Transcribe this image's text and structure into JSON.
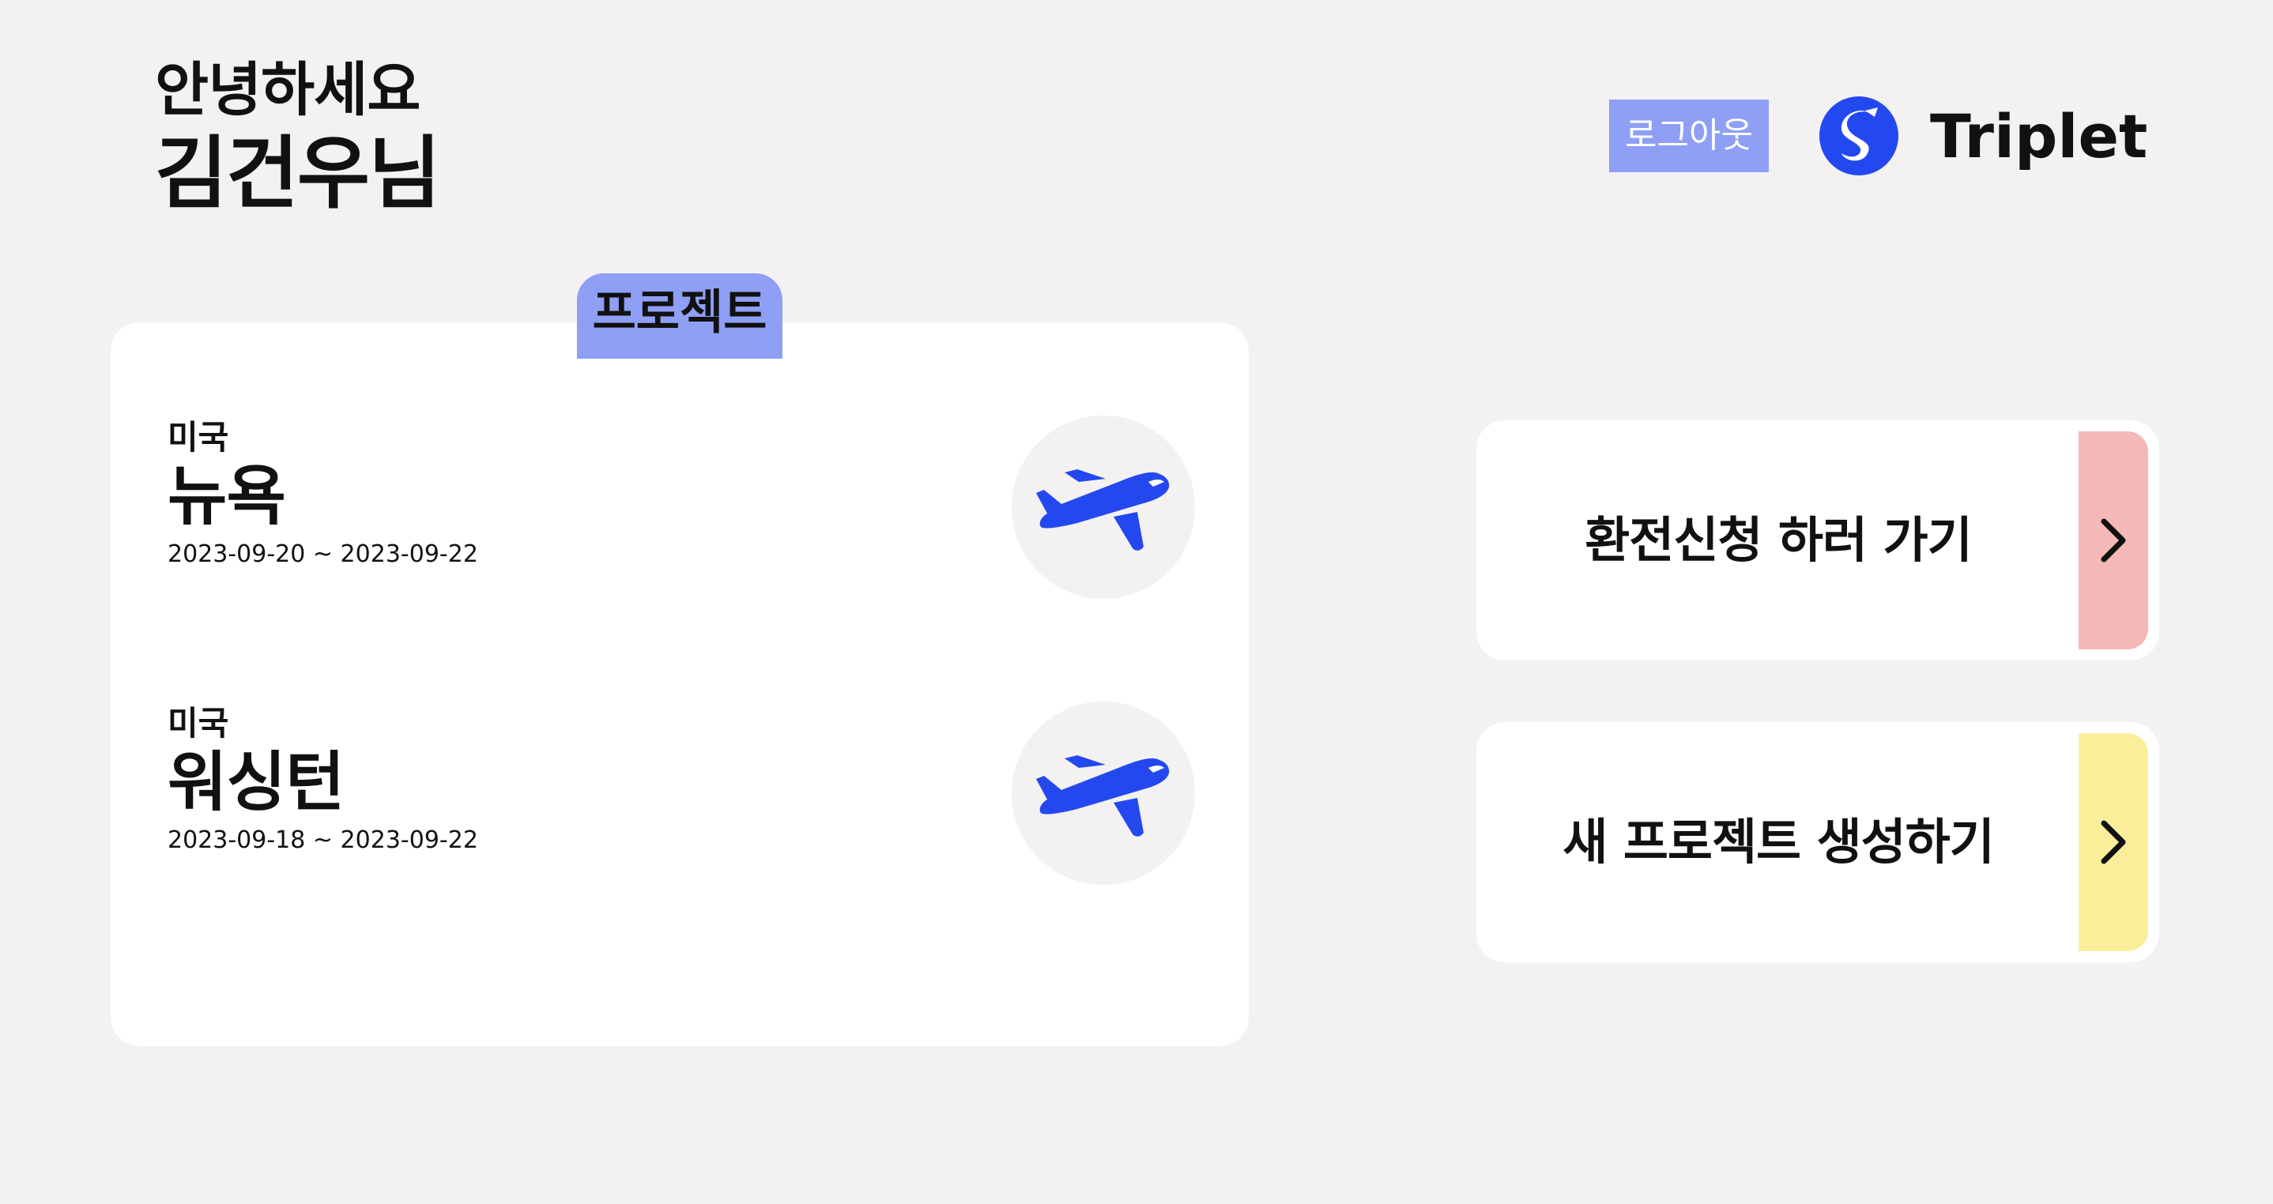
{
  "header": {
    "greeting": "안녕하세요",
    "user_name": "김건우님",
    "logout_label": "로그아웃",
    "brand_name": "Triplet",
    "logo_icon": "shinhan-s-icon"
  },
  "projects": {
    "tab_label": "프로젝트",
    "items": [
      {
        "country": "미국",
        "city": "뉴욕",
        "dates": "2023-09-20 ~ 2023-09-22",
        "icon": "airplane-icon"
      },
      {
        "country": "미국",
        "city": "워싱턴",
        "dates": "2023-09-18 ~ 2023-09-22",
        "icon": "airplane-icon"
      }
    ]
  },
  "actions": {
    "exchange": {
      "label": "환전신청 하러 가기",
      "icon": "chevron-right-icon"
    },
    "create_project": {
      "label": "새 프로젝트 생성하기",
      "icon": "chevron-right-icon"
    }
  },
  "colors": {
    "background": "#f3f1f2",
    "accent": "#8e9ff5",
    "plane": "#2448f0",
    "exchange_arrow_bg": "#f4b8b7",
    "create_arrow_bg": "#fbee9b",
    "card": "#ffffff"
  }
}
